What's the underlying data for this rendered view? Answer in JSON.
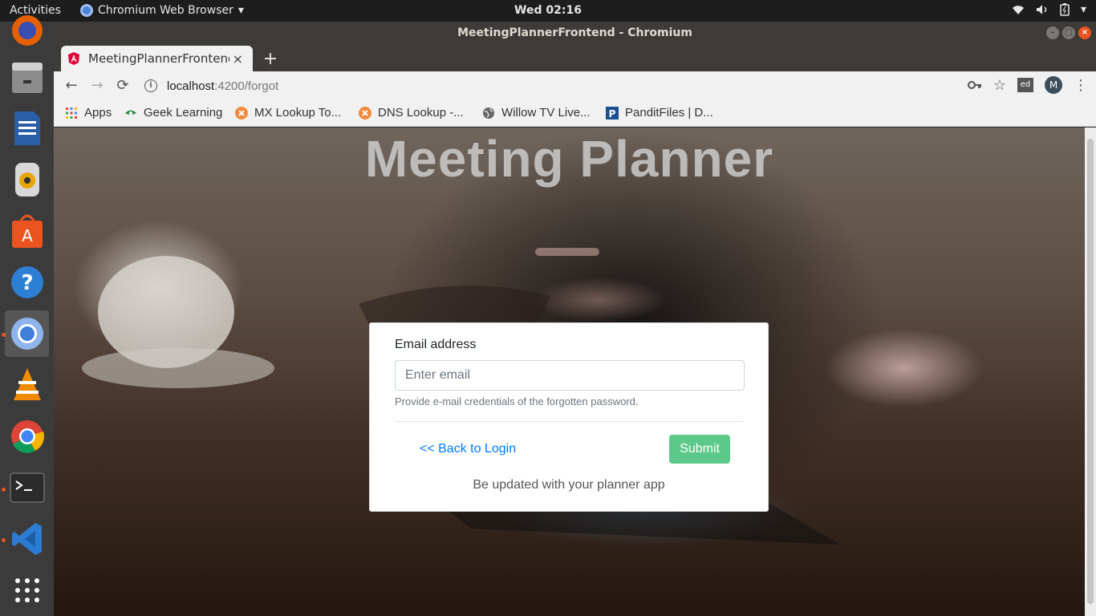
{
  "topbar": {
    "activities": "Activities",
    "app_name": "Chromium Web Browser",
    "clock": "Wed 02:16"
  },
  "window": {
    "title": "MeetingPlannerFrontend - Chromium"
  },
  "tab": {
    "title": "MeetingPlannerFrontend",
    "close": "×",
    "new_tab": "+"
  },
  "address_bar": {
    "host": "localhost",
    "path": ":4200/forgot"
  },
  "bookmarks": [
    {
      "label": "Apps",
      "icon": "apps-grid-icon"
    },
    {
      "label": "Geek Learning",
      "icon": "geek-icon"
    },
    {
      "label": "MX Lookup To...",
      "icon": "mxtoolbox-icon"
    },
    {
      "label": "DNS Lookup -...",
      "icon": "mxtoolbox-icon"
    },
    {
      "label": "Willow TV Live...",
      "icon": "globe-icon"
    },
    {
      "label": "PanditFiles | D...",
      "icon": "panditfiles-icon"
    }
  ],
  "profile": {
    "initial": "M",
    "extension": "ed"
  },
  "page": {
    "heading": "Meeting Planner",
    "form": {
      "email_label": "Email address",
      "email_placeholder": "Enter email",
      "email_value": "",
      "help_text": "Provide e-mail credentials of the forgotten password.",
      "back_link": "<< Back to Login",
      "submit_label": "Submit",
      "tagline": "Be updated with your planner app"
    }
  },
  "colors": {
    "ubuntu_orange": "#e95420",
    "link_blue": "#007bff",
    "submit_green": "#5cc98a"
  }
}
